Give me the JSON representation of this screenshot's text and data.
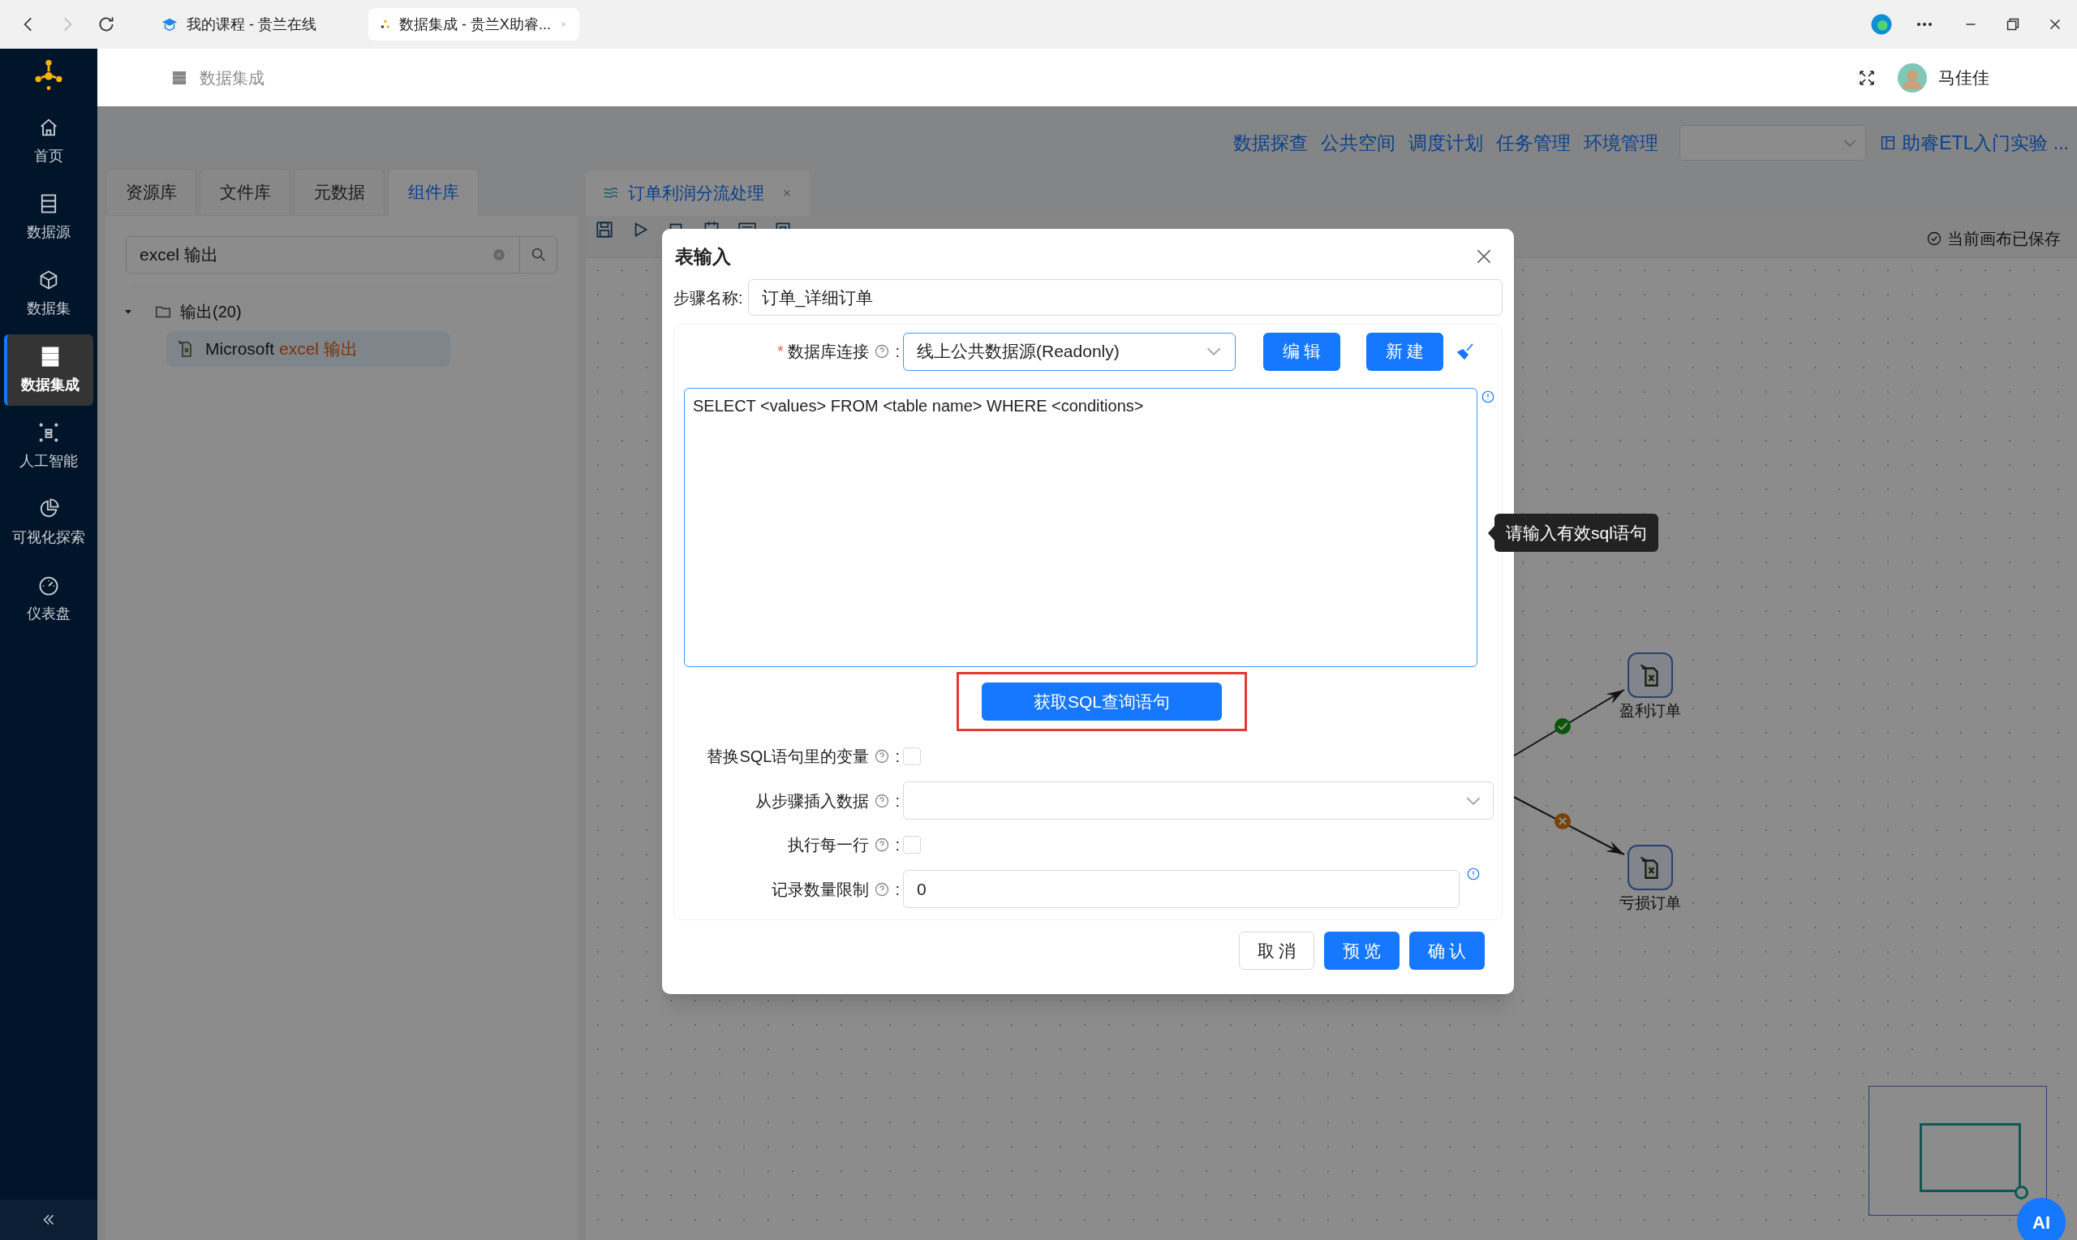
{
  "browser": {
    "tabs": [
      {
        "title": "我的课程 - 贵兰在线",
        "selected": false
      },
      {
        "title": "数据集成 - 贵兰X助睿...",
        "selected": true
      }
    ]
  },
  "sidebar": {
    "items": [
      {
        "label": "首页",
        "selected": false
      },
      {
        "label": "数据源",
        "selected": false
      },
      {
        "label": "数据集",
        "selected": false
      },
      {
        "label": "数据集成",
        "selected": true
      },
      {
        "label": "人工智能",
        "selected": false
      },
      {
        "label": "可视化探索",
        "selected": false
      },
      {
        "label": "仪表盘",
        "selected": false
      }
    ]
  },
  "header": {
    "title": "数据集成",
    "user": "马佳佳"
  },
  "top_links": [
    "数据探查",
    "公共空间",
    "调度计划",
    "任务管理",
    "环境管理"
  ],
  "project": "助睿ETL入门实验 ...",
  "left_panel": {
    "tabs": [
      {
        "label": "资源库",
        "selected": false
      },
      {
        "label": "文件库",
        "selected": false
      },
      {
        "label": "元数据",
        "selected": false
      },
      {
        "label": "组件库",
        "selected": true
      }
    ],
    "search": {
      "value": "excel 输出"
    },
    "tree": [
      {
        "label": "输出(20)",
        "expanded": true,
        "children": [
          {
            "label": "Microsoft ",
            "match": "excel 输出",
            "selected": true
          }
        ]
      }
    ]
  },
  "canvas": {
    "tab": "订单利润分流处理",
    "save_status": "当前画布已保存",
    "nodes": [
      {
        "label": "盈利订单"
      },
      {
        "label": "亏损订单"
      }
    ],
    "links": [
      {
        "kind": "success"
      },
      {
        "kind": "failure"
      }
    ]
  },
  "dialog": {
    "title": "表输入",
    "step_name": {
      "label": "步骤名称:",
      "value": "订单_详细订单"
    },
    "connection": {
      "label": "数据库连接",
      "required_mark": "*",
      "colon": ":",
      "value": "线上公共数据源(Readonly)",
      "buttons": [
        "编 辑",
        "新 建"
      ]
    },
    "sql": {
      "value": "SELECT <values> FROM <table name> WHERE <conditions>",
      "tooltip": "请输入有效sql语句"
    },
    "get_sql_button": "获取SQL查询语句",
    "fields": [
      {
        "kind": "checkbox",
        "label": "替换SQL语句里的变量",
        "colon": ":",
        "checked": false
      },
      {
        "kind": "select",
        "label": "从步骤插入数据",
        "colon": ":"
      },
      {
        "kind": "checkbox",
        "label": "执行每一行",
        "colon": ":",
        "checked": false
      },
      {
        "kind": "input",
        "label": "记录数量限制",
        "colon": ":",
        "value": "0"
      }
    ],
    "buttons": [
      {
        "label": "取 消",
        "kind": "default"
      },
      {
        "label": "预 览",
        "kind": "primary"
      },
      {
        "label": "确 认",
        "kind": "primary"
      }
    ]
  },
  "ai_button": "AI"
}
